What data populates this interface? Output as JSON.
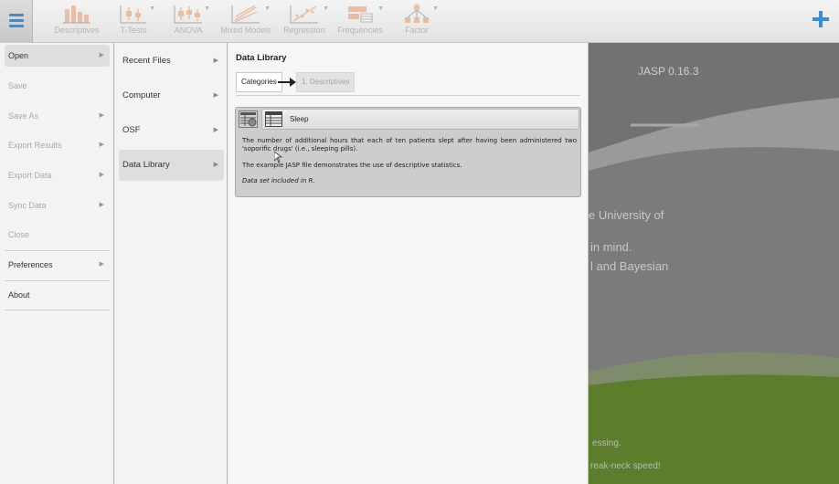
{
  "toolbar": {
    "buttons": [
      {
        "label": "Descriptives",
        "icon": "descriptives-icon"
      },
      {
        "label": "T-Tests",
        "icon": "t-tests-icon"
      },
      {
        "label": "ANOVA",
        "icon": "anova-icon"
      },
      {
        "label": "Mixed Models",
        "icon": "mixed-models-icon"
      },
      {
        "label": "Regression",
        "icon": "regression-icon"
      },
      {
        "label": "Frequencies",
        "icon": "frequencies-icon"
      },
      {
        "label": "Factor",
        "icon": "factor-icon"
      }
    ],
    "menu_icon": "hamburger-menu-icon",
    "add_icon": "plus-icon",
    "accent_color": "#3a8ed5",
    "analysis_icon_color": "#e5844a"
  },
  "file_menu": {
    "items": [
      {
        "label": "Open",
        "enabled": true,
        "selected": true,
        "has_submenu": true
      },
      {
        "label": "Save",
        "enabled": false
      },
      {
        "label": "Save As",
        "enabled": false,
        "has_submenu": true
      },
      {
        "label": "Export Results",
        "enabled": false,
        "has_submenu": true
      },
      {
        "label": "Export Data",
        "enabled": false,
        "has_submenu": true
      },
      {
        "label": "Sync Data",
        "enabled": false,
        "has_submenu": true
      },
      {
        "label": "Close",
        "enabled": false
      },
      {
        "label": "Preferences",
        "enabled": true,
        "has_submenu": true
      },
      {
        "label": "About",
        "enabled": true
      }
    ]
  },
  "open_menu": {
    "items": [
      {
        "label": "Recent Files"
      },
      {
        "label": "Computer"
      },
      {
        "label": "OSF"
      },
      {
        "label": "Data Library",
        "selected": true
      }
    ]
  },
  "data_library": {
    "title": "Data Library",
    "breadcrumb": {
      "root": "Categories",
      "current": "1. Descriptives"
    },
    "dataset": {
      "name": "Sleep",
      "description": "The number of additional hours that each of ten patients slept after having been administered two 'soporific drugs' (i.e., sleeping pills).",
      "example_note": "The example JASP file demonstrates the use of descriptive statistics.",
      "included_note": "Data set included in R."
    }
  },
  "welcome": {
    "version": "JASP 0.16.3",
    "line1": "e University of",
    "line2": "in mind.",
    "line3": "l and Bayesian",
    "line4": "essing.",
    "line5": "reak-neck speed!"
  }
}
